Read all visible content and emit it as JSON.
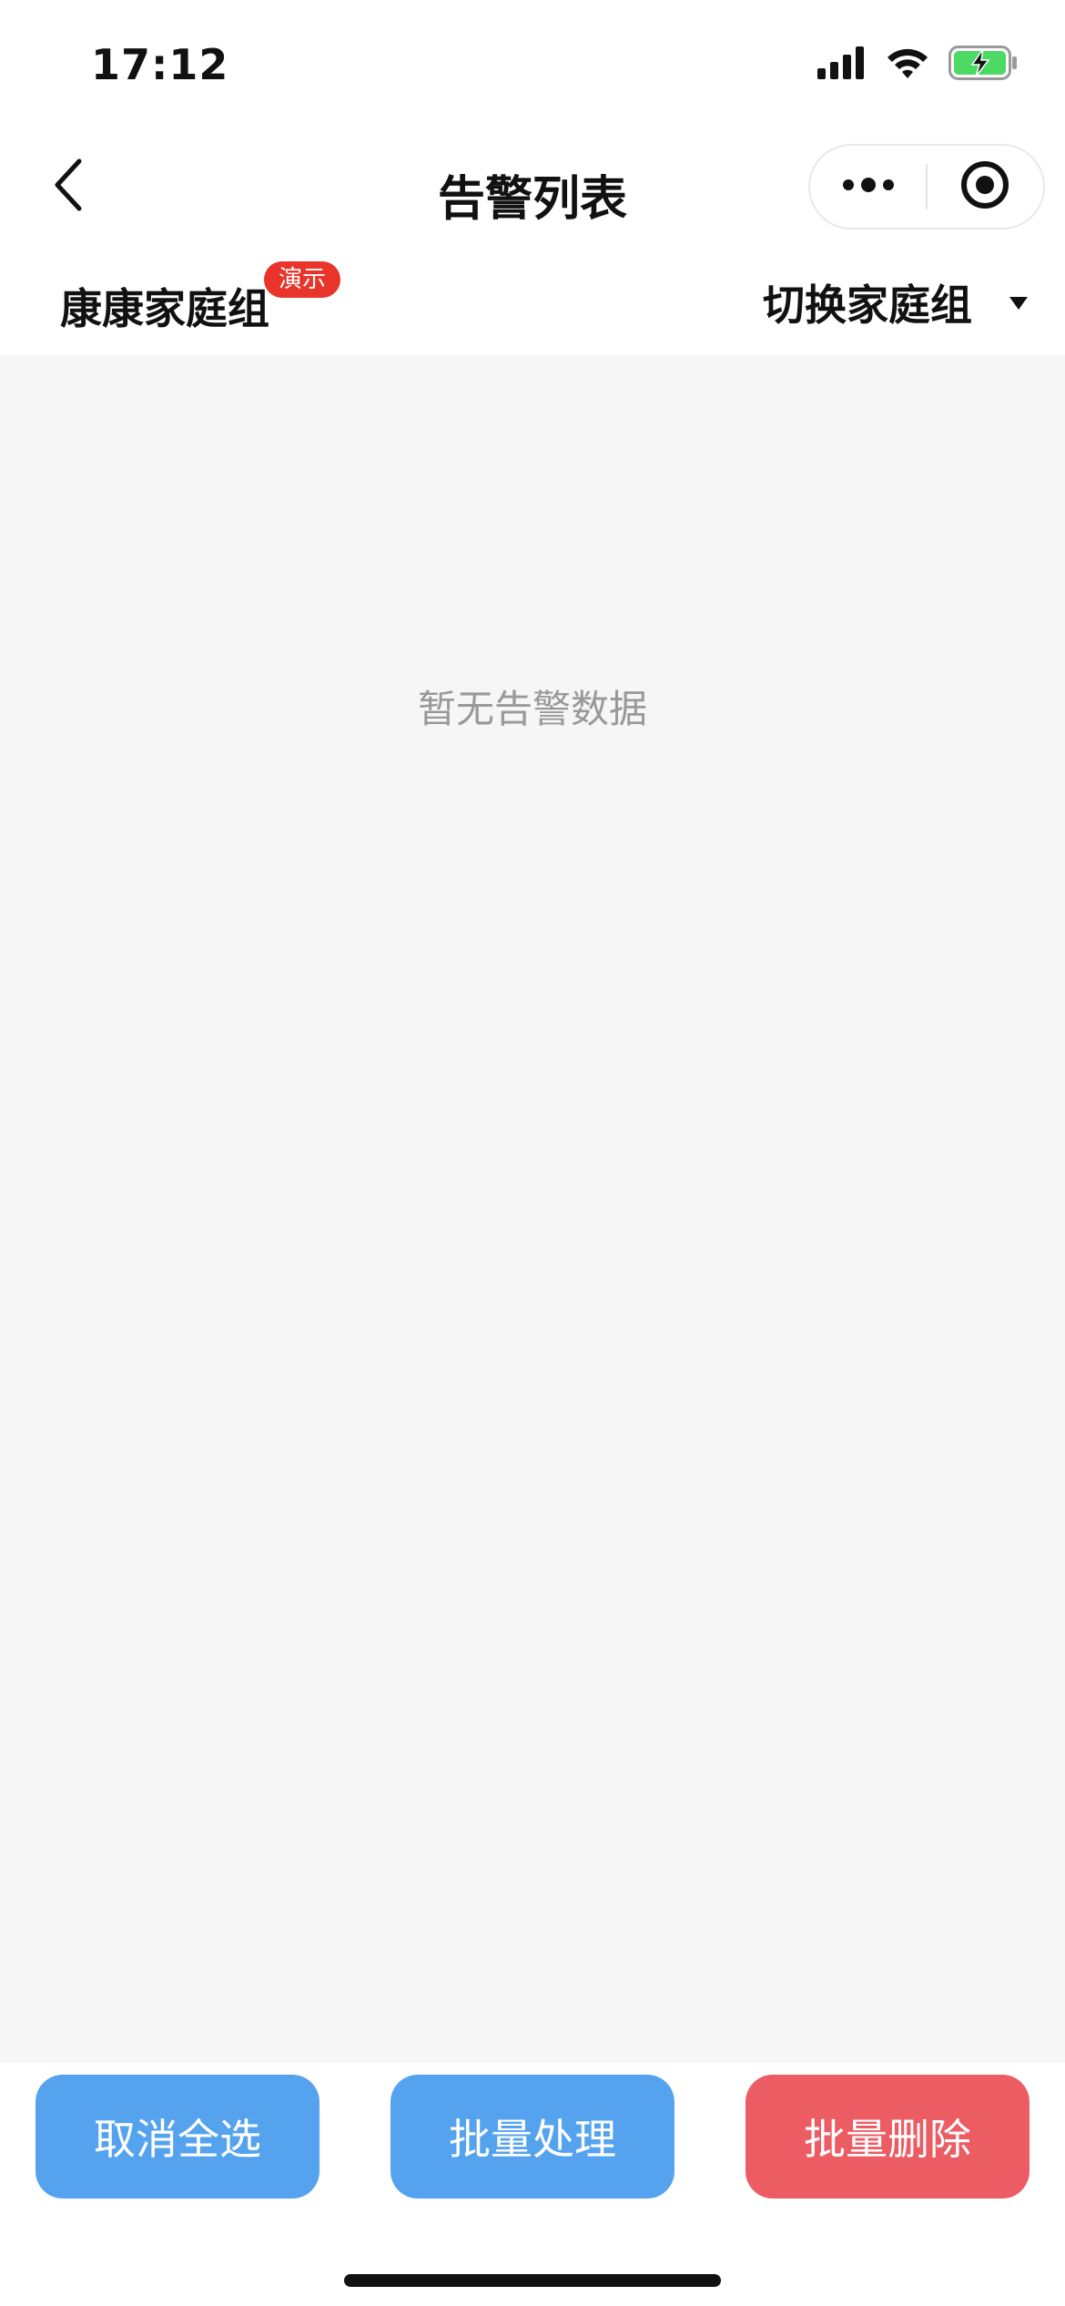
{
  "status_bar": {
    "time": "17:12",
    "icons": [
      "signal-icon",
      "wifi-icon",
      "battery-charging-icon"
    ],
    "battery_color": "#4cd964"
  },
  "nav": {
    "title": "告警列表",
    "back_icon": "chevron-left-icon",
    "more_icon": "more-dots-icon",
    "close_icon": "target-circle-icon"
  },
  "group_bar": {
    "group_name": "康康家庭组",
    "badge": "演示",
    "switch_label": "切换家庭组",
    "switch_icon": "caret-down-icon"
  },
  "content": {
    "empty_text": "暂无告警数据"
  },
  "actions": {
    "cancel_select_all": "取消全选",
    "batch_process": "批量处理",
    "batch_delete": "批量删除"
  },
  "colors": {
    "primary_button": "#55a3ef",
    "danger_button": "#ec5c63",
    "badge": "#e8342b",
    "page_background": "#f6f6f6"
  }
}
